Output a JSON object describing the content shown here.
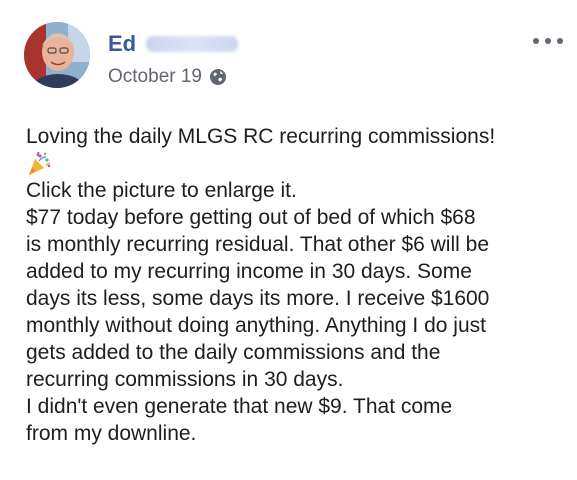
{
  "post": {
    "author": {
      "name": "Ed",
      "avatar_icon": "profile-photo"
    },
    "date": "October 19",
    "privacy_icon": "globe-icon",
    "more_icon": "ellipsis-icon",
    "lines": [
      "Loving the daily MLGS RC recurring commissions!",
      "Click the picture to enlarge it.",
      "$77 today before getting out of bed of which $68",
      "is monthly recurring residual. That other $6 will be",
      "added to my recurring income in 30 days. Some",
      "days its less, some days its more. I receive $1600",
      "monthly without doing anything. Anything I do just",
      "gets added to the daily commissions and the",
      "recurring commissions in 30 days.",
      "I didn't even generate that new $9. That come",
      "from my downline."
    ],
    "emoji_icon": "party-popper-icon",
    "colors": {
      "name": "#385898",
      "meta": "#616770",
      "text": "#1c1e21"
    }
  }
}
